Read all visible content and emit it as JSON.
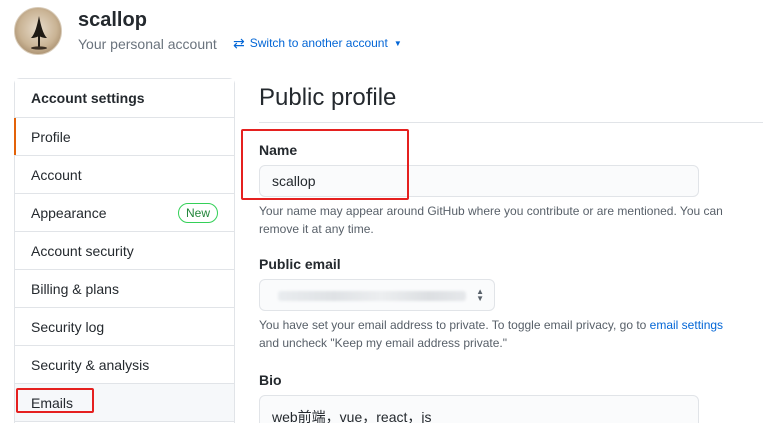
{
  "header": {
    "username": "scallop",
    "account_type": "Your personal account",
    "switch_label": "Switch to another account",
    "switch_icon": "arrow-switch-icon",
    "caret_icon": "triangle-down-icon"
  },
  "sidebar": {
    "heading": "Account settings",
    "items": [
      {
        "label": "Profile",
        "name": "sidebar-item-profile"
      },
      {
        "label": "Account",
        "name": "sidebar-item-account"
      },
      {
        "label": "Appearance",
        "name": "sidebar-item-appearance",
        "badge": "New"
      },
      {
        "label": "Account security",
        "name": "sidebar-item-account-security"
      },
      {
        "label": "Billing & plans",
        "name": "sidebar-item-billing"
      },
      {
        "label": "Security log",
        "name": "sidebar-item-security-log"
      },
      {
        "label": "Security & analysis",
        "name": "sidebar-item-security-analysis"
      },
      {
        "label": "Emails",
        "name": "sidebar-item-emails"
      }
    ],
    "selected": "Profile"
  },
  "main": {
    "title": "Public profile",
    "name_field": {
      "label": "Name",
      "value": "scallop",
      "note": "Your name may appear around GitHub where you contribute or are mentioned. You can remove it at any time."
    },
    "email_field": {
      "label": "Public email",
      "note_before": "You have set your email address to private. To toggle email privacy, go to ",
      "note_link": "email settings",
      "note_after": " and uncheck \"Keep my email address private.\""
    },
    "bio_field": {
      "label": "Bio",
      "value": "web前端，vue，react，js"
    }
  },
  "colors": {
    "accent_selected": "#e36209",
    "link": "#0366d6",
    "badge_green": "#22863a",
    "annotation_red": "#e5201f"
  }
}
